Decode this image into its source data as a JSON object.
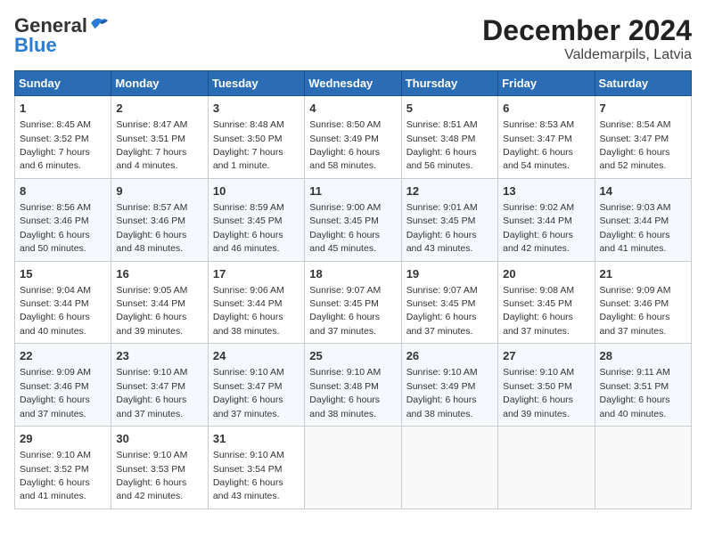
{
  "logo": {
    "general": "General",
    "blue": "Blue"
  },
  "title": "December 2024",
  "subtitle": "Valdemarpils, Latvia",
  "days_header": [
    "Sunday",
    "Monday",
    "Tuesday",
    "Wednesday",
    "Thursday",
    "Friday",
    "Saturday"
  ],
  "weeks": [
    [
      {
        "day": "1",
        "info": "Sunrise: 8:45 AM\nSunset: 3:52 PM\nDaylight: 7 hours\nand 6 minutes."
      },
      {
        "day": "2",
        "info": "Sunrise: 8:47 AM\nSunset: 3:51 PM\nDaylight: 7 hours\nand 4 minutes."
      },
      {
        "day": "3",
        "info": "Sunrise: 8:48 AM\nSunset: 3:50 PM\nDaylight: 7 hours\nand 1 minute."
      },
      {
        "day": "4",
        "info": "Sunrise: 8:50 AM\nSunset: 3:49 PM\nDaylight: 6 hours\nand 58 minutes."
      },
      {
        "day": "5",
        "info": "Sunrise: 8:51 AM\nSunset: 3:48 PM\nDaylight: 6 hours\nand 56 minutes."
      },
      {
        "day": "6",
        "info": "Sunrise: 8:53 AM\nSunset: 3:47 PM\nDaylight: 6 hours\nand 54 minutes."
      },
      {
        "day": "7",
        "info": "Sunrise: 8:54 AM\nSunset: 3:47 PM\nDaylight: 6 hours\nand 52 minutes."
      }
    ],
    [
      {
        "day": "8",
        "info": "Sunrise: 8:56 AM\nSunset: 3:46 PM\nDaylight: 6 hours\nand 50 minutes."
      },
      {
        "day": "9",
        "info": "Sunrise: 8:57 AM\nSunset: 3:46 PM\nDaylight: 6 hours\nand 48 minutes."
      },
      {
        "day": "10",
        "info": "Sunrise: 8:59 AM\nSunset: 3:45 PM\nDaylight: 6 hours\nand 46 minutes."
      },
      {
        "day": "11",
        "info": "Sunrise: 9:00 AM\nSunset: 3:45 PM\nDaylight: 6 hours\nand 45 minutes."
      },
      {
        "day": "12",
        "info": "Sunrise: 9:01 AM\nSunset: 3:45 PM\nDaylight: 6 hours\nand 43 minutes."
      },
      {
        "day": "13",
        "info": "Sunrise: 9:02 AM\nSunset: 3:44 PM\nDaylight: 6 hours\nand 42 minutes."
      },
      {
        "day": "14",
        "info": "Sunrise: 9:03 AM\nSunset: 3:44 PM\nDaylight: 6 hours\nand 41 minutes."
      }
    ],
    [
      {
        "day": "15",
        "info": "Sunrise: 9:04 AM\nSunset: 3:44 PM\nDaylight: 6 hours\nand 40 minutes."
      },
      {
        "day": "16",
        "info": "Sunrise: 9:05 AM\nSunset: 3:44 PM\nDaylight: 6 hours\nand 39 minutes."
      },
      {
        "day": "17",
        "info": "Sunrise: 9:06 AM\nSunset: 3:44 PM\nDaylight: 6 hours\nand 38 minutes."
      },
      {
        "day": "18",
        "info": "Sunrise: 9:07 AM\nSunset: 3:45 PM\nDaylight: 6 hours\nand 37 minutes."
      },
      {
        "day": "19",
        "info": "Sunrise: 9:07 AM\nSunset: 3:45 PM\nDaylight: 6 hours\nand 37 minutes."
      },
      {
        "day": "20",
        "info": "Sunrise: 9:08 AM\nSunset: 3:45 PM\nDaylight: 6 hours\nand 37 minutes."
      },
      {
        "day": "21",
        "info": "Sunrise: 9:09 AM\nSunset: 3:46 PM\nDaylight: 6 hours\nand 37 minutes."
      }
    ],
    [
      {
        "day": "22",
        "info": "Sunrise: 9:09 AM\nSunset: 3:46 PM\nDaylight: 6 hours\nand 37 minutes."
      },
      {
        "day": "23",
        "info": "Sunrise: 9:10 AM\nSunset: 3:47 PM\nDaylight: 6 hours\nand 37 minutes."
      },
      {
        "day": "24",
        "info": "Sunrise: 9:10 AM\nSunset: 3:47 PM\nDaylight: 6 hours\nand 37 minutes."
      },
      {
        "day": "25",
        "info": "Sunrise: 9:10 AM\nSunset: 3:48 PM\nDaylight: 6 hours\nand 38 minutes."
      },
      {
        "day": "26",
        "info": "Sunrise: 9:10 AM\nSunset: 3:49 PM\nDaylight: 6 hours\nand 38 minutes."
      },
      {
        "day": "27",
        "info": "Sunrise: 9:10 AM\nSunset: 3:50 PM\nDaylight: 6 hours\nand 39 minutes."
      },
      {
        "day": "28",
        "info": "Sunrise: 9:11 AM\nSunset: 3:51 PM\nDaylight: 6 hours\nand 40 minutes."
      }
    ],
    [
      {
        "day": "29",
        "info": "Sunrise: 9:10 AM\nSunset: 3:52 PM\nDaylight: 6 hours\nand 41 minutes."
      },
      {
        "day": "30",
        "info": "Sunrise: 9:10 AM\nSunset: 3:53 PM\nDaylight: 6 hours\nand 42 minutes."
      },
      {
        "day": "31",
        "info": "Sunrise: 9:10 AM\nSunset: 3:54 PM\nDaylight: 6 hours\nand 43 minutes."
      },
      null,
      null,
      null,
      null
    ]
  ]
}
